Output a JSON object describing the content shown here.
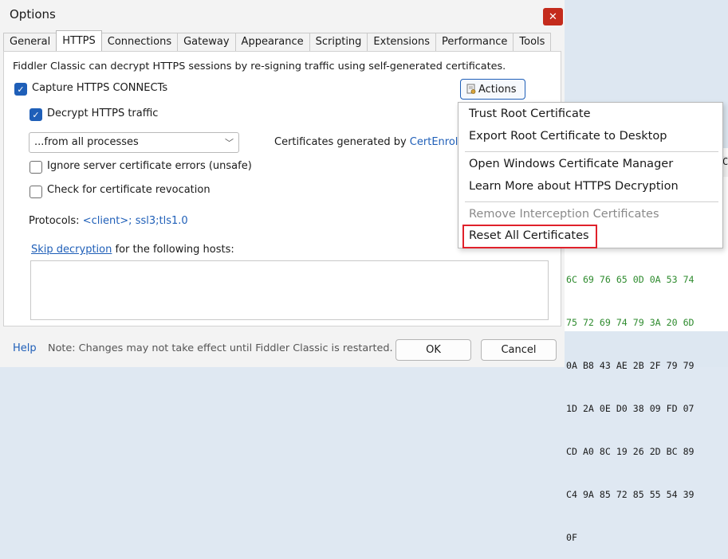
{
  "dialog": {
    "title": "Options"
  },
  "tabs": [
    "General",
    "HTTPS",
    "Connections",
    "Gateway",
    "Appearance",
    "Scripting",
    "Extensions",
    "Performance",
    "Tools"
  ],
  "https": {
    "description": "Fiddler Classic can decrypt HTTPS sessions by re-signing traffic using self-generated certificates.",
    "capture_label": "Capture HTTPS CONNECTs",
    "decrypt_label": "Decrypt HTTPS traffic",
    "process_filter": "...from all processes",
    "cert_text": "Certificates generated by ",
    "cert_link": "CertEnroll",
    "cert_tail": " e",
    "ignore_errors_label": "Ignore server certificate errors (unsafe)",
    "revocation_label": "Check for certificate revocation",
    "protocols_label": "Protocols: ",
    "protocols_value": "<client>; ssl3;tls1.0",
    "skip_link": "Skip decryption",
    "skip_tail": " for the following hosts:",
    "actions_label": "Actions"
  },
  "menu": {
    "items": [
      "Trust Root Certificate",
      "Export Root Certificate to Desktop",
      "Open Windows Certificate Manager",
      "Learn More about HTTPS Decryption",
      "Remove Interception Certificates",
      "Reset All Certificates"
    ]
  },
  "footer": {
    "help": "Help",
    "note": "Note: Changes may not take effect until Fiddler Classic is restarted.",
    "ok": "OK",
    "cancel": "Cancel"
  },
  "inspector": {
    "header_partial": "Ca",
    "hex_lines": [
      "6C 69 76 65 0D 0A 53 74",
      "75 72 69 74 79 3A 20 6D",
      "0A B8 43 AE 2B 2F 79 79",
      "1D 2A 0E D0 38 09 FD 07",
      "CD A0 8C 19 26 2D BC 89",
      "C4 9A 85 72 85 55 54 39",
      "0F"
    ]
  },
  "colors": {
    "accent": "#1f5fb8",
    "close": "#c42b1c",
    "highlight": "#e0212b",
    "hex_green": "#2e8b2e"
  }
}
